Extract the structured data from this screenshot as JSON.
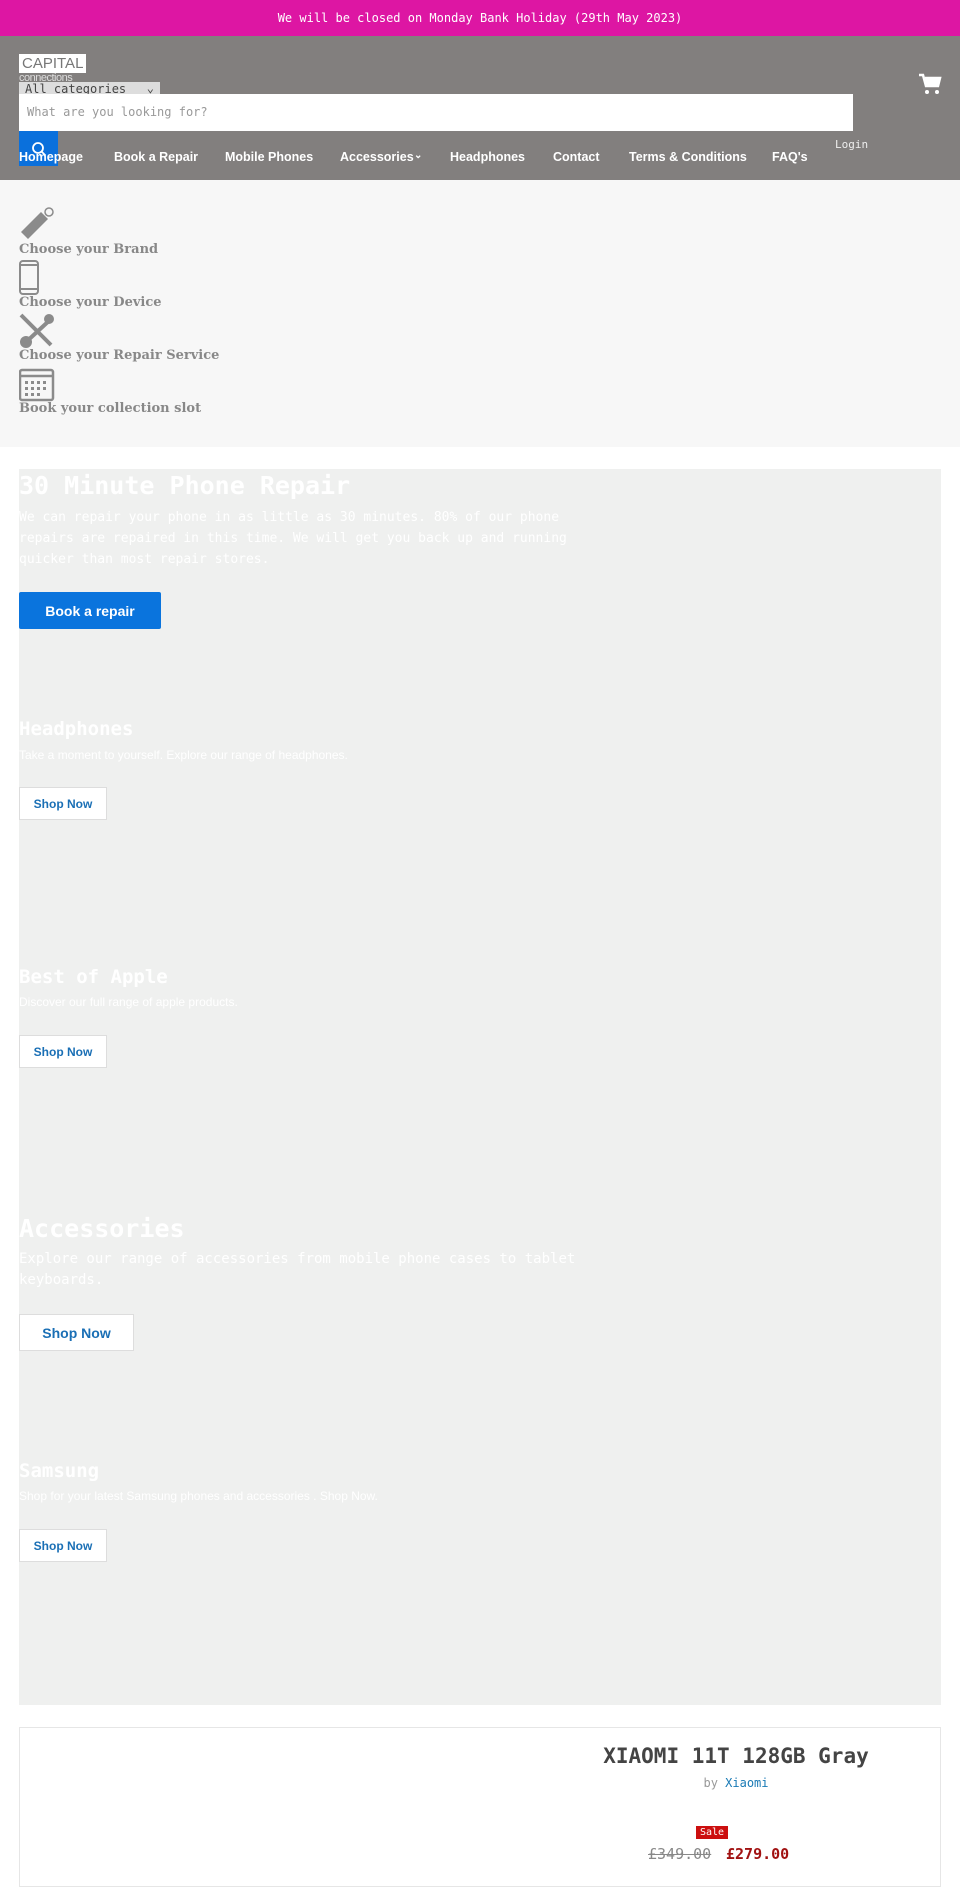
{
  "banner": {
    "text": "We will be closed on Monday Bank Holiday (29th May 2023)",
    "color": "#dd16a3"
  },
  "header": {
    "logo": {
      "top": "CAPITAL",
      "bottom": "connections"
    },
    "category_select": "All categories",
    "search_placeholder": "What are you looking for?",
    "login": "Login",
    "nav": [
      "Homepage",
      "Book a Repair",
      "Mobile Phones",
      "Accessories",
      "Headphones",
      "Contact",
      "Terms & Conditions",
      "FAQ's"
    ]
  },
  "steps": [
    {
      "label": "Choose your Brand",
      "icon": "tag-icon"
    },
    {
      "label": "Choose your Device",
      "icon": "phone-icon"
    },
    {
      "label": "Choose your Repair Service",
      "icon": "tools-icon"
    },
    {
      "label": "Book your collection slot",
      "icon": "calendar-icon"
    }
  ],
  "hero": {
    "title": "30 Minute Phone Repair",
    "text": "We can repair your phone in as little as 30 minutes. 80% of our phone repairs are repaired in this time. We will get you back up and running quicker than most repair stores.",
    "button": "Book a repair"
  },
  "promos": [
    {
      "title": "Headphones",
      "text": "Take a moment to yourself. Explore our range of headphones.",
      "button": "Shop Now"
    },
    {
      "title": "Best of Apple",
      "text": "Discover our full range of apple products.",
      "button": "Shop Now"
    },
    {
      "title": "Accessories",
      "text": "Explore our range of accessories from mobile phone cases to tablet keyboards.",
      "button": "Shop Now"
    },
    {
      "title": "Samsung",
      "text": "Shop for your latest Samsung phones and accessories . Shop Now.",
      "button": "Shop Now"
    }
  ],
  "product": {
    "title": "XIAOMI 11T 128GB Gray",
    "by": "by",
    "vendor": "Xiaomi",
    "badge": "Sale",
    "old_price": "£349.00",
    "price": "£279.00"
  }
}
